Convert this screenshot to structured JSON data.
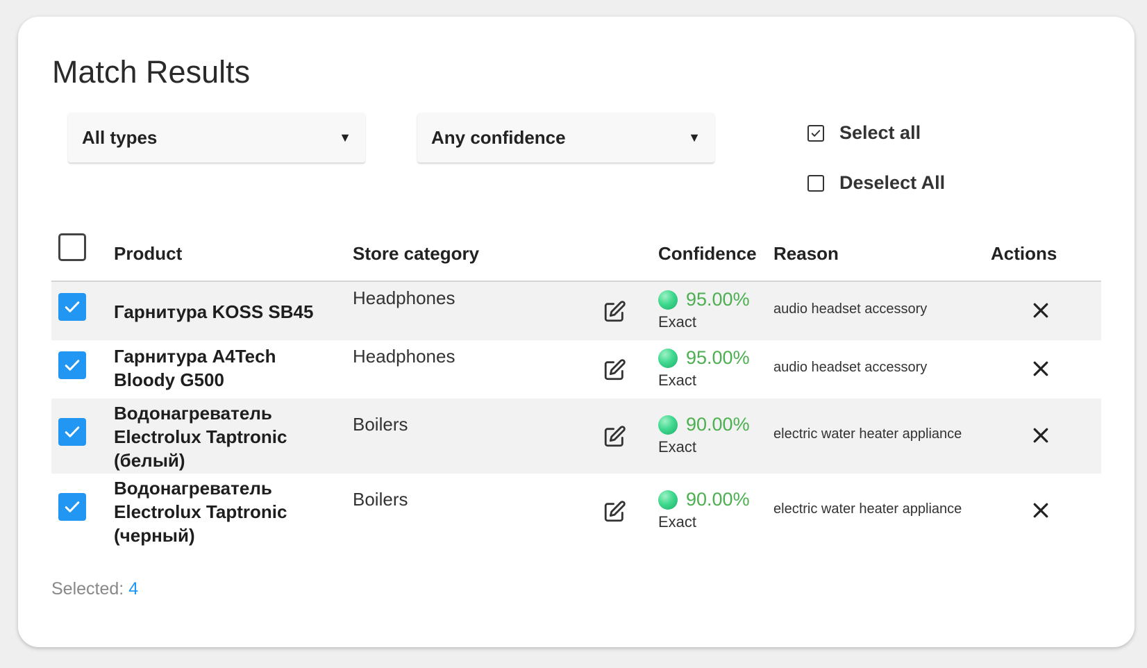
{
  "header": {
    "title": "Match Results"
  },
  "filters": {
    "type": {
      "selected": "All types"
    },
    "confidence": {
      "selected": "Any confidence"
    }
  },
  "bulk": {
    "select_all": "Select all",
    "deselect_all": "Deselect All"
  },
  "table": {
    "columns": [
      "Product",
      "Store category",
      "Confidence",
      "Reason",
      "Actions"
    ],
    "rows": [
      {
        "product": "Гарнитура KOSS SB45",
        "category": "Headphones",
        "confidence": "95.00%",
        "match_type": "Exact",
        "reason": "audio headset accessory",
        "checked": true
      },
      {
        "product": "Гарнитура A4Tech Bloody G500",
        "category": "Headphones",
        "confidence": "95.00%",
        "match_type": "Exact",
        "reason": "audio headset accessory",
        "checked": true
      },
      {
        "product": "Водонагреватель Electrolux Taptronic (белый)",
        "category": "Boilers",
        "confidence": "90.00%",
        "match_type": "Exact",
        "reason": "electric water heater appliance",
        "checked": true
      },
      {
        "product": "Водонагреватель Electrolux Taptronic (черный)",
        "category": "Boilers",
        "confidence": "90.00%",
        "match_type": "Exact",
        "reason": "electric water heater appliance",
        "checked": true
      }
    ]
  },
  "footer": {
    "selected_label": "Selected:",
    "selected_count": "4"
  },
  "icons": {
    "edit": "edit-icon",
    "delete": "close-icon",
    "checkbox": "checkmark-icon",
    "confidence": "status-dot-icon"
  },
  "colors": {
    "accent": "#2196f3",
    "confidence_text": "#4caf50",
    "row_alt": "#f2f2f2"
  }
}
